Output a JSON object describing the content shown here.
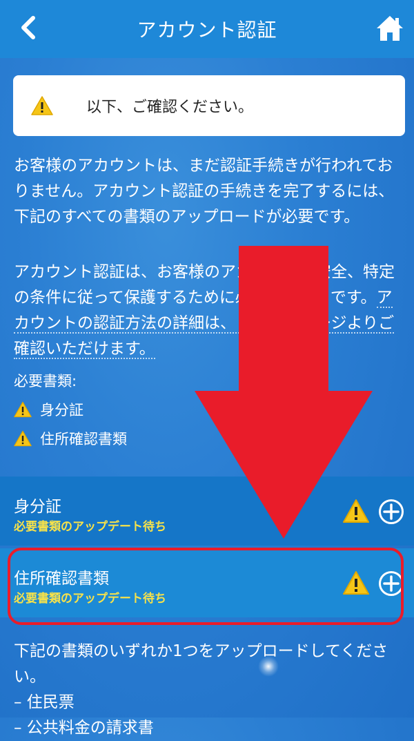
{
  "header": {
    "title": "アカウント認証"
  },
  "notice": {
    "text": "以下、ご確認ください。"
  },
  "paragraphs": {
    "p1": "お客様のアカウントは、まだ認証手続きが行われておりません。アカウント認証の手続きを完了するには、下記のすべての書類のアップロードが必要です。",
    "p2_before": "アカウント認証は、お客様のアカウントの安全、特定の条件に従って保護するために必要な手続きです。",
    "p2_link": "アカウントの認証方法の詳細は、こちらのページよりご確認いただけます。"
  },
  "required": {
    "title": "必要書類:",
    "items": [
      "身分証",
      "住所確認書類"
    ]
  },
  "documents": [
    {
      "name": "身分証",
      "status": "必要書類のアップデート待ち"
    },
    {
      "name": "住所確認書類",
      "status": "必要書類のアップデート待ち"
    }
  ],
  "bottom": {
    "line1": "下記の書類のいずれか1つをアップロードしてください。",
    "line2": "– 住民票",
    "line3": "– 公共料金の請求書"
  },
  "colors": {
    "accent_yellow": "#f7e24a",
    "highlight_red": "#e91c2a",
    "header_blue": "#1e88d8"
  }
}
